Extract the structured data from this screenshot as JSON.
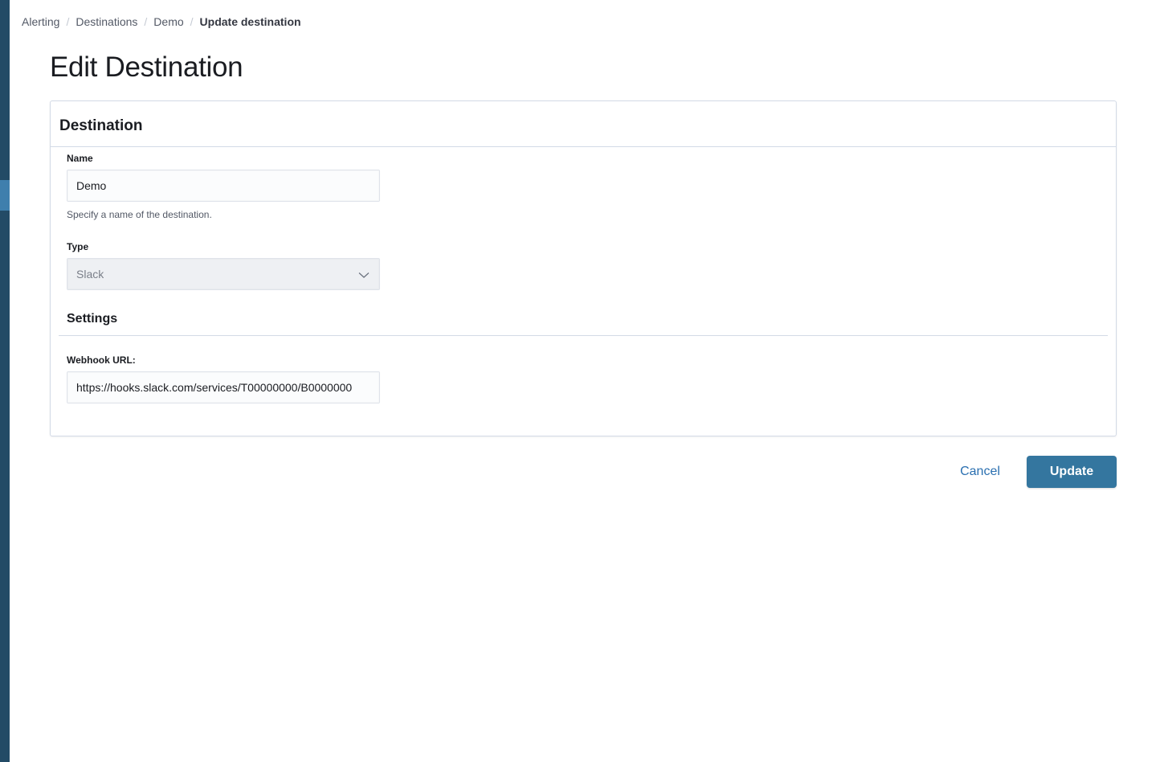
{
  "breadcrumbs": {
    "items": [
      "Alerting",
      "Destinations",
      "Demo"
    ],
    "current": "Update destination",
    "separator": "/"
  },
  "page": {
    "title": "Edit Destination"
  },
  "panel": {
    "title": "Destination",
    "name": {
      "label": "Name",
      "value": "Demo",
      "help": "Specify a name of the destination."
    },
    "type": {
      "label": "Type",
      "value": "Slack",
      "icon": "chevron-down-icon"
    },
    "settings": {
      "title": "Settings",
      "webhook_label": "Webhook URL:",
      "webhook_value": "https://hooks.slack.com/services/T00000000/B0000000"
    }
  },
  "actions": {
    "cancel": "Cancel",
    "update": "Update"
  },
  "colors": {
    "sidebar": "#234b66",
    "sidebar_active": "#3f7fad",
    "primary": "#34769f",
    "link": "#2a6fb0"
  }
}
